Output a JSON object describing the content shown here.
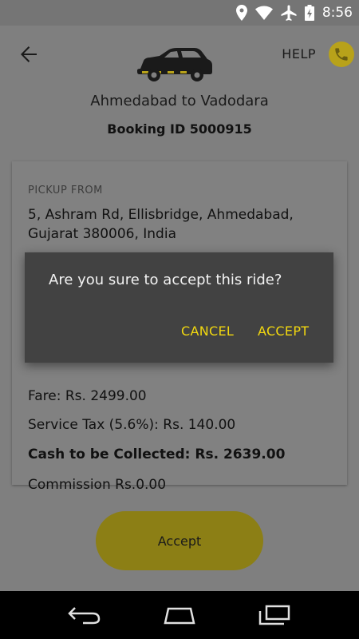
{
  "status_bar": {
    "time": "8:56",
    "icons": [
      "location-icon",
      "wifi-icon",
      "airplane-icon",
      "battery-charging-icon"
    ]
  },
  "header": {
    "help_label": "HELP",
    "route": "Ahmedabad to Vadodara",
    "booking_id": "Booking ID 5000915"
  },
  "ride": {
    "pickup_label": "PICKUP FROM",
    "pickup_address": "5, Ashram Rd, Ellisbridge, Ahmedabad, Gujarat 380006, India",
    "fare": "Fare: Rs. 2499.00",
    "service_tax": "Service Tax (5.6%): Rs. 140.00",
    "cash_to_collect": "Cash to be Collected: Rs. 2639.00",
    "commission": "Commission Rs.0.00"
  },
  "footer": {
    "accept_label": "Accept"
  },
  "dialog": {
    "message": "Are you sure to accept this ride?",
    "cancel_label": "CANCEL",
    "accept_label": "ACCEPT"
  },
  "colors": {
    "accent_yellow": "#f2d80f",
    "dialog_bg": "#424242",
    "scrim": "#7f7f7f"
  }
}
